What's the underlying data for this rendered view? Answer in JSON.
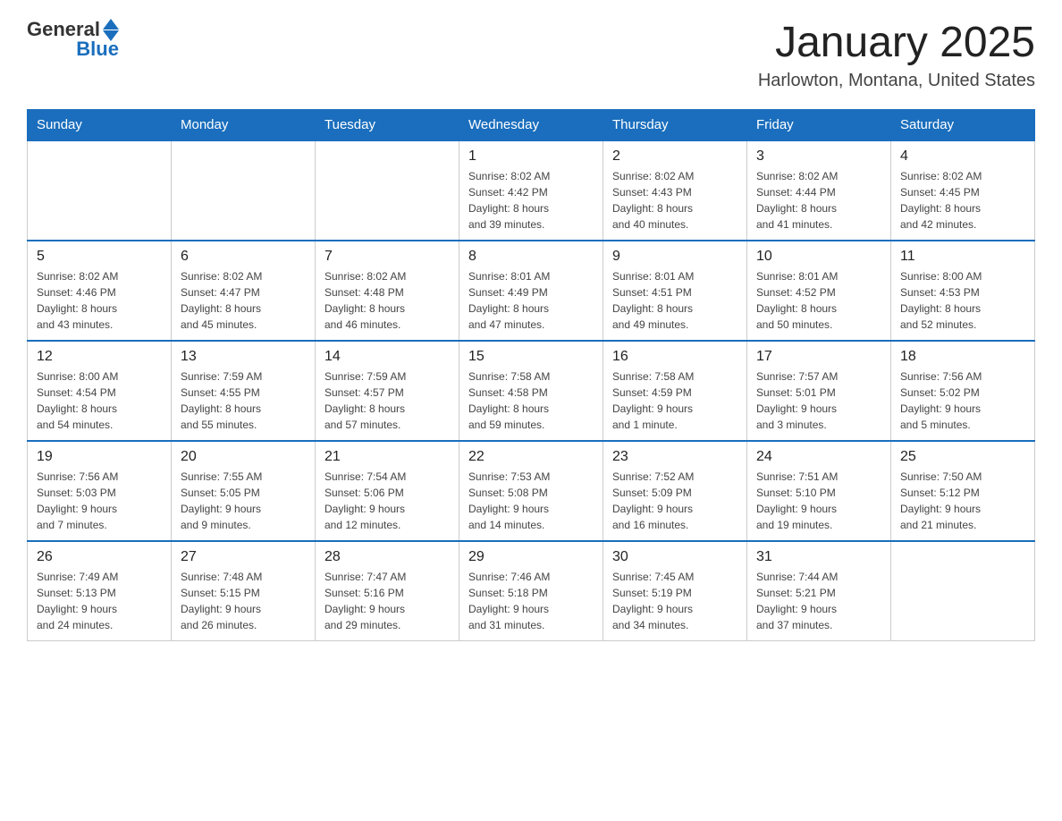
{
  "header": {
    "logo_general": "General",
    "logo_blue": "Blue",
    "title": "January 2025",
    "subtitle": "Harlowton, Montana, United States"
  },
  "days_of_week": [
    "Sunday",
    "Monday",
    "Tuesday",
    "Wednesday",
    "Thursday",
    "Friday",
    "Saturday"
  ],
  "weeks": [
    [
      {
        "day": "",
        "info": ""
      },
      {
        "day": "",
        "info": ""
      },
      {
        "day": "",
        "info": ""
      },
      {
        "day": "1",
        "info": "Sunrise: 8:02 AM\nSunset: 4:42 PM\nDaylight: 8 hours\nand 39 minutes."
      },
      {
        "day": "2",
        "info": "Sunrise: 8:02 AM\nSunset: 4:43 PM\nDaylight: 8 hours\nand 40 minutes."
      },
      {
        "day": "3",
        "info": "Sunrise: 8:02 AM\nSunset: 4:44 PM\nDaylight: 8 hours\nand 41 minutes."
      },
      {
        "day": "4",
        "info": "Sunrise: 8:02 AM\nSunset: 4:45 PM\nDaylight: 8 hours\nand 42 minutes."
      }
    ],
    [
      {
        "day": "5",
        "info": "Sunrise: 8:02 AM\nSunset: 4:46 PM\nDaylight: 8 hours\nand 43 minutes."
      },
      {
        "day": "6",
        "info": "Sunrise: 8:02 AM\nSunset: 4:47 PM\nDaylight: 8 hours\nand 45 minutes."
      },
      {
        "day": "7",
        "info": "Sunrise: 8:02 AM\nSunset: 4:48 PM\nDaylight: 8 hours\nand 46 minutes."
      },
      {
        "day": "8",
        "info": "Sunrise: 8:01 AM\nSunset: 4:49 PM\nDaylight: 8 hours\nand 47 minutes."
      },
      {
        "day": "9",
        "info": "Sunrise: 8:01 AM\nSunset: 4:51 PM\nDaylight: 8 hours\nand 49 minutes."
      },
      {
        "day": "10",
        "info": "Sunrise: 8:01 AM\nSunset: 4:52 PM\nDaylight: 8 hours\nand 50 minutes."
      },
      {
        "day": "11",
        "info": "Sunrise: 8:00 AM\nSunset: 4:53 PM\nDaylight: 8 hours\nand 52 minutes."
      }
    ],
    [
      {
        "day": "12",
        "info": "Sunrise: 8:00 AM\nSunset: 4:54 PM\nDaylight: 8 hours\nand 54 minutes."
      },
      {
        "day": "13",
        "info": "Sunrise: 7:59 AM\nSunset: 4:55 PM\nDaylight: 8 hours\nand 55 minutes."
      },
      {
        "day": "14",
        "info": "Sunrise: 7:59 AM\nSunset: 4:57 PM\nDaylight: 8 hours\nand 57 minutes."
      },
      {
        "day": "15",
        "info": "Sunrise: 7:58 AM\nSunset: 4:58 PM\nDaylight: 8 hours\nand 59 minutes."
      },
      {
        "day": "16",
        "info": "Sunrise: 7:58 AM\nSunset: 4:59 PM\nDaylight: 9 hours\nand 1 minute."
      },
      {
        "day": "17",
        "info": "Sunrise: 7:57 AM\nSunset: 5:01 PM\nDaylight: 9 hours\nand 3 minutes."
      },
      {
        "day": "18",
        "info": "Sunrise: 7:56 AM\nSunset: 5:02 PM\nDaylight: 9 hours\nand 5 minutes."
      }
    ],
    [
      {
        "day": "19",
        "info": "Sunrise: 7:56 AM\nSunset: 5:03 PM\nDaylight: 9 hours\nand 7 minutes."
      },
      {
        "day": "20",
        "info": "Sunrise: 7:55 AM\nSunset: 5:05 PM\nDaylight: 9 hours\nand 9 minutes."
      },
      {
        "day": "21",
        "info": "Sunrise: 7:54 AM\nSunset: 5:06 PM\nDaylight: 9 hours\nand 12 minutes."
      },
      {
        "day": "22",
        "info": "Sunrise: 7:53 AM\nSunset: 5:08 PM\nDaylight: 9 hours\nand 14 minutes."
      },
      {
        "day": "23",
        "info": "Sunrise: 7:52 AM\nSunset: 5:09 PM\nDaylight: 9 hours\nand 16 minutes."
      },
      {
        "day": "24",
        "info": "Sunrise: 7:51 AM\nSunset: 5:10 PM\nDaylight: 9 hours\nand 19 minutes."
      },
      {
        "day": "25",
        "info": "Sunrise: 7:50 AM\nSunset: 5:12 PM\nDaylight: 9 hours\nand 21 minutes."
      }
    ],
    [
      {
        "day": "26",
        "info": "Sunrise: 7:49 AM\nSunset: 5:13 PM\nDaylight: 9 hours\nand 24 minutes."
      },
      {
        "day": "27",
        "info": "Sunrise: 7:48 AM\nSunset: 5:15 PM\nDaylight: 9 hours\nand 26 minutes."
      },
      {
        "day": "28",
        "info": "Sunrise: 7:47 AM\nSunset: 5:16 PM\nDaylight: 9 hours\nand 29 minutes."
      },
      {
        "day": "29",
        "info": "Sunrise: 7:46 AM\nSunset: 5:18 PM\nDaylight: 9 hours\nand 31 minutes."
      },
      {
        "day": "30",
        "info": "Sunrise: 7:45 AM\nSunset: 5:19 PM\nDaylight: 9 hours\nand 34 minutes."
      },
      {
        "day": "31",
        "info": "Sunrise: 7:44 AM\nSunset: 5:21 PM\nDaylight: 9 hours\nand 37 minutes."
      },
      {
        "day": "",
        "info": ""
      }
    ]
  ]
}
